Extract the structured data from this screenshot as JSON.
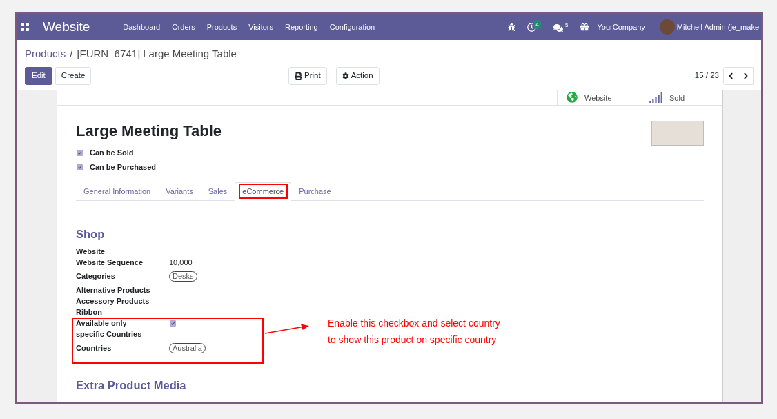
{
  "navbar": {
    "app_title": "Website",
    "menu": [
      "Dashboard",
      "Orders",
      "Products",
      "Visitors",
      "Reporting",
      "Configuration"
    ],
    "activity_count": "4",
    "message_count": "5",
    "company": "YourCompany",
    "user": "Mitchell Admin (je_make"
  },
  "breadcrumb": {
    "parent": "Products",
    "separator": "/",
    "current": "[FURN_6741] Large Meeting Table"
  },
  "buttons": [
    {
      "kind": "primary",
      "label": "Edit"
    },
    {
      "kind": "secondary",
      "label": "Create"
    }
  ],
  "menus": [
    {
      "kind": "print",
      "label": "Print"
    },
    {
      "kind": "gear",
      "label": "Action"
    }
  ],
  "pager": {
    "value": "15 / 23"
  },
  "smart_buttons": [
    {
      "kind": "globe",
      "label": "Website"
    },
    {
      "kind": "chart",
      "label": "Sold"
    }
  ],
  "product": {
    "name": "Large Meeting Table",
    "options": [
      {
        "label": "Can be Sold",
        "checked": true
      },
      {
        "label": "Can be Purchased",
        "checked": true
      }
    ]
  },
  "tabs": [
    {
      "label": "General Information",
      "selected": false,
      "highlighted": false
    },
    {
      "label": "Variants",
      "selected": false,
      "highlighted": false
    },
    {
      "label": "Sales",
      "selected": false,
      "highlighted": false
    },
    {
      "label": "eCommerce",
      "selected": true,
      "highlighted": true
    },
    {
      "label": "Purchase",
      "selected": false,
      "highlighted": false
    }
  ],
  "shop": {
    "title": "Shop",
    "fields": [
      {
        "kind": "text",
        "label": "Website",
        "highlighted": false
      },
      {
        "kind": "text",
        "label": "Website Sequence",
        "value": "10,000",
        "highlighted": false
      },
      {
        "kind": "tag",
        "label": "Categories",
        "value": "Desks",
        "highlighted": false
      },
      {
        "kind": "text",
        "label": "Alternative Products",
        "highlighted": false
      },
      {
        "kind": "text",
        "label": "Accessory Products",
        "highlighted": false
      },
      {
        "kind": "text",
        "label": "Ribbon",
        "highlighted": false
      },
      {
        "kind": "checkbox",
        "label": "Available only specific Countries",
        "checked": true,
        "highlighted": true
      },
      {
        "kind": "tag",
        "label": "Countries",
        "value": "Australia",
        "highlighted": true
      }
    ]
  },
  "annotation": {
    "lines": [
      "Enable this checkbox and select country",
      "to show this product on specific country"
    ]
  },
  "extra_media": {
    "title": "Extra Product Media"
  }
}
